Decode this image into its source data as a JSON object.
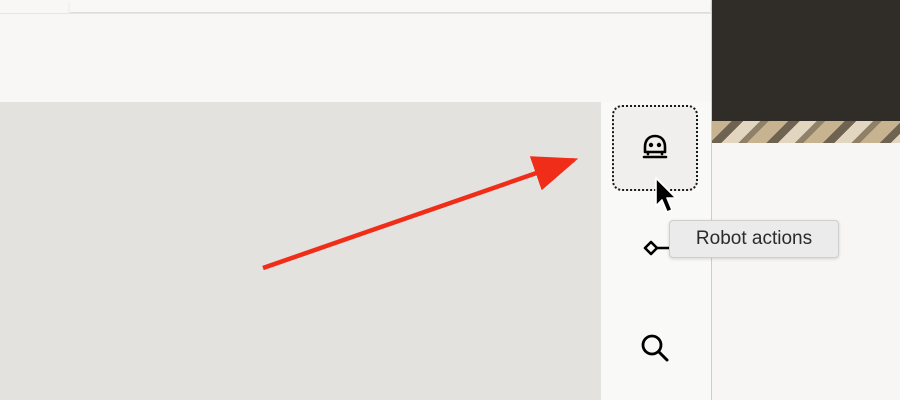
{
  "tooltip": {
    "text": "Robot actions"
  },
  "rail": {
    "buttons": [
      {
        "name": "robot-actions",
        "icon": "robot-icon",
        "state": "active"
      },
      {
        "name": "flow",
        "icon": "diamond-connector-icon",
        "state": "default"
      },
      {
        "name": "search",
        "icon": "search-icon",
        "state": "default"
      }
    ]
  },
  "annotation": {
    "arrow_color": "#f02d18"
  },
  "colors": {
    "canvas": "#e3e2df",
    "rail": "#f9f9f8",
    "active_outline": "#1a1a1a",
    "tooltip_bg": "#ebebeb"
  }
}
